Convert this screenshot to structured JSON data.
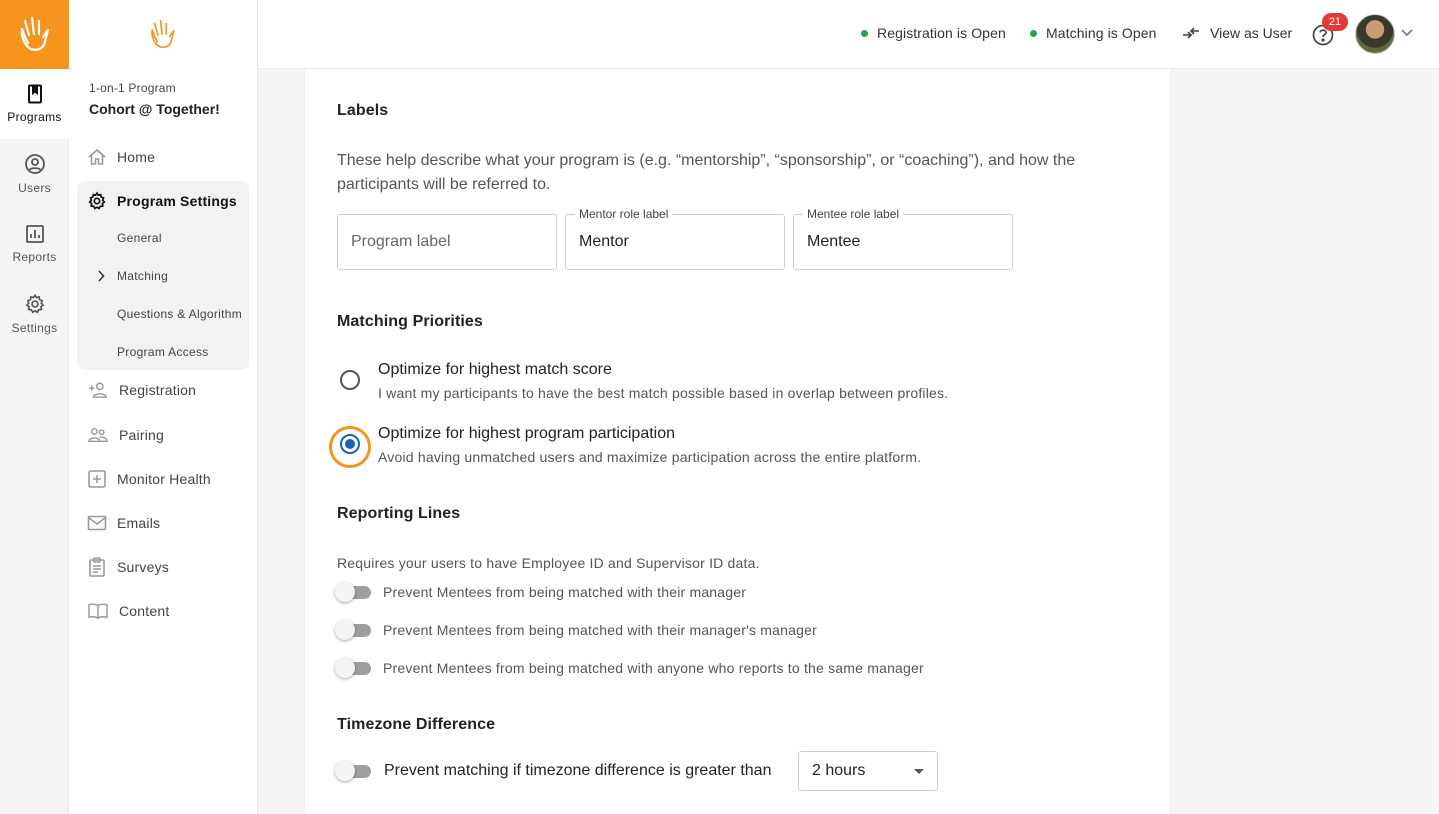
{
  "rail": {
    "items": [
      {
        "label": "Programs",
        "icon": "book-icon",
        "active": true
      },
      {
        "label": "Users",
        "icon": "user-circle-icon",
        "active": false
      },
      {
        "label": "Reports",
        "icon": "bar-chart-icon",
        "active": false
      },
      {
        "label": "Settings",
        "icon": "gear-icon",
        "active": false
      }
    ]
  },
  "sidebar": {
    "program_type": "1-on-1 Program",
    "program_name": "Cohort @ Together!",
    "items": [
      {
        "label": "Home",
        "icon": "home-icon"
      },
      {
        "label": "Program Settings",
        "icon": "gear-icon"
      },
      {
        "label": "Registration",
        "icon": "add-user-icon"
      },
      {
        "label": "Pairing",
        "icon": "people-icon"
      },
      {
        "label": "Monitor Health",
        "icon": "plus-box-icon"
      },
      {
        "label": "Emails",
        "icon": "envelope-icon"
      },
      {
        "label": "Surveys",
        "icon": "clipboard-icon"
      },
      {
        "label": "Content",
        "icon": "open-book-icon"
      }
    ],
    "settings_sub": [
      "General",
      "Matching",
      "Questions & Algorithm",
      "Program Access"
    ],
    "active_sub": "Matching"
  },
  "topbar": {
    "registration_status": "Registration is Open",
    "matching_status": "Matching is Open",
    "view_as_user": "View as User",
    "notification_count": "21",
    "status_color": "#2e9e4f",
    "accent": "#f7941d"
  },
  "labels_section": {
    "title": "Labels",
    "description": "These help describe what your program is (e.g. “mentorship”, “sponsorship”, or “coaching”), and how the participants will be referred to.",
    "program_label": {
      "placeholder": "Program label",
      "value": ""
    },
    "mentor_label": {
      "label": "Mentor role label",
      "value": "Mentor"
    },
    "mentee_label": {
      "label": "Mentee role label",
      "value": "Mentee"
    }
  },
  "matching_priorities": {
    "title": "Matching Priorities",
    "options": [
      {
        "title": "Optimize for highest match score",
        "description": "I want my participants to have the best match possible based in overlap between profiles.",
        "selected": false
      },
      {
        "title": "Optimize for highest program participation",
        "description": "Avoid having unmatched users and maximize participation across the entire platform.",
        "selected": true
      }
    ]
  },
  "reporting_lines": {
    "title": "Reporting Lines",
    "requirement": "Requires your users to have Employee ID and Supervisor ID data.",
    "toggles": [
      {
        "label": "Prevent Mentees from being matched with their manager",
        "on": false
      },
      {
        "label": "Prevent Mentees from being matched with their manager's manager",
        "on": false
      },
      {
        "label": "Prevent Mentees from being matched with anyone who reports to the same manager",
        "on": false
      }
    ]
  },
  "timezone": {
    "title": "Timezone Difference",
    "toggle_label": "Prevent matching if timezone difference is greater than",
    "toggle_on": false,
    "selected": "2 hours"
  }
}
